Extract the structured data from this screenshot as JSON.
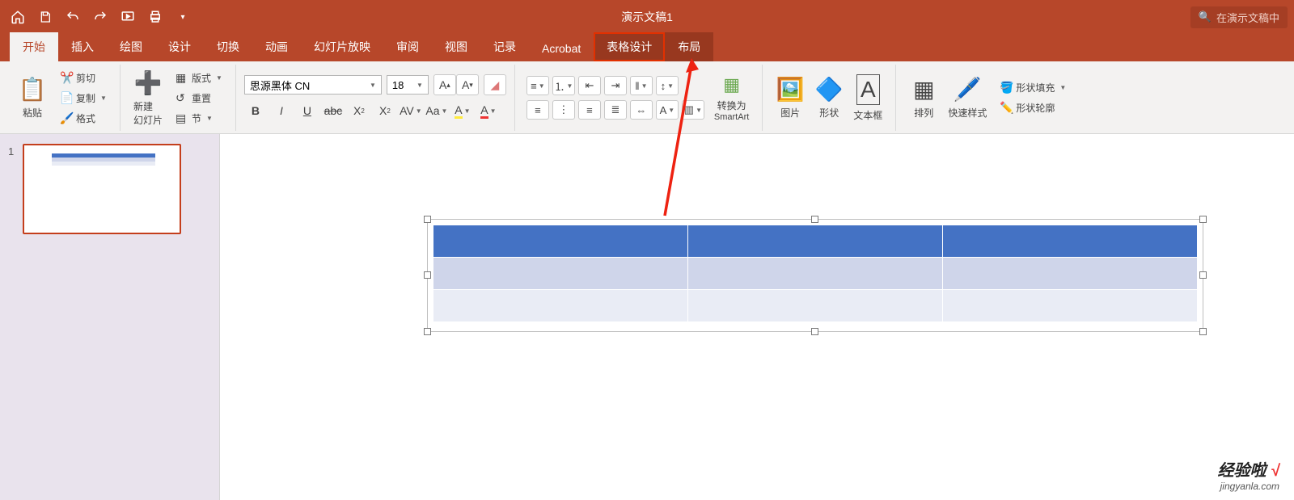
{
  "title": "演示文稿1",
  "search": {
    "placeholder": "在演示文稿中"
  },
  "tabs": {
    "home": "开始",
    "insert": "插入",
    "draw": "绘图",
    "design": "设计",
    "transitions": "切换",
    "animations": "动画",
    "slideshow": "幻灯片放映",
    "review": "审阅",
    "view": "视图",
    "record": "记录",
    "acrobat": "Acrobat",
    "table_design": "表格设计",
    "layout": "布局"
  },
  "ribbon": {
    "paste": "粘贴",
    "cut": "剪切",
    "copy": "复制",
    "format": "格式",
    "new_slide": "新建\n幻灯片",
    "layout_btn": "版式",
    "reset": "重置",
    "section": "节",
    "font_name": "思源黑体 CN",
    "font_size": "18",
    "convert_smartart_l1": "转换为",
    "convert_smartart_l2": "SmartArt",
    "picture": "图片",
    "shapes": "形状",
    "textbox": "文本框",
    "arrange": "排列",
    "quick_styles": "快速样式",
    "shape_fill": "形状填充",
    "shape_outline": "形状轮廓"
  },
  "slide_panel": {
    "num1": "1"
  },
  "watermark": {
    "line1": "经验啦",
    "check": "√",
    "line2": "jingyanla.com"
  }
}
